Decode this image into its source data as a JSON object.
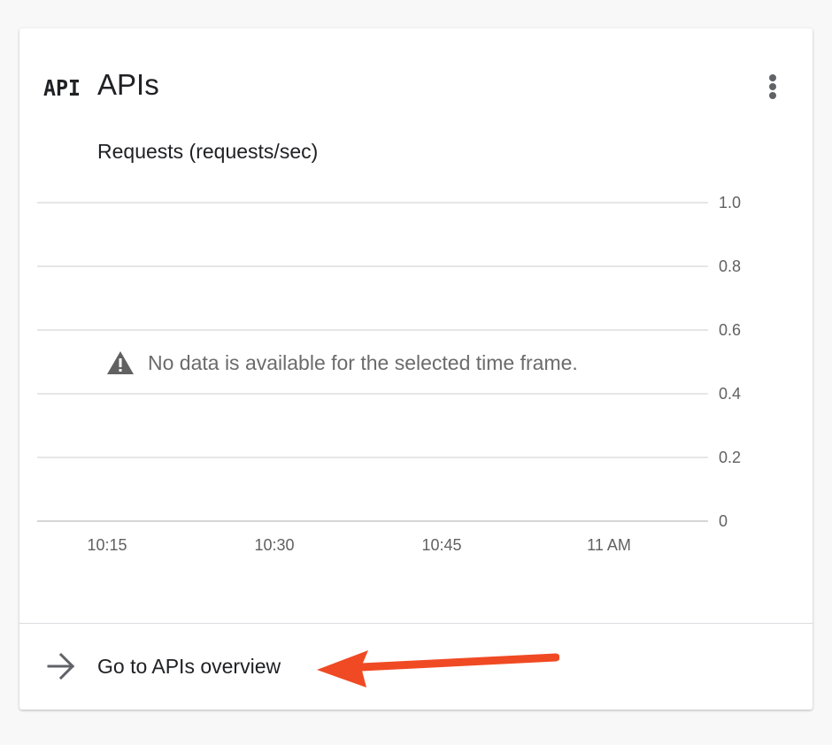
{
  "card": {
    "title": "APIs",
    "icon_text": "API",
    "menu_icon": "more-vert-icon"
  },
  "chart_data": {
    "type": "line",
    "title": "Requests (requests/sec)",
    "x": [
      "10:15",
      "10:30",
      "10:45",
      "11 AM"
    ],
    "y_ticks": [
      "1.0",
      "0.8",
      "0.6",
      "0.4",
      "0.2",
      "0"
    ],
    "ylim": [
      0,
      1.0
    ],
    "series": [],
    "grid": true,
    "y_axis_position": "right",
    "empty_message": "No data is available for the selected time frame."
  },
  "footer": {
    "link_label": "Go to APIs overview",
    "link_icon": "arrow-right-icon"
  },
  "colors": {
    "annotation_arrow": "#f04a24",
    "text": "#202124",
    "muted_text": "#616161",
    "gridline": "#e6e6e6"
  }
}
